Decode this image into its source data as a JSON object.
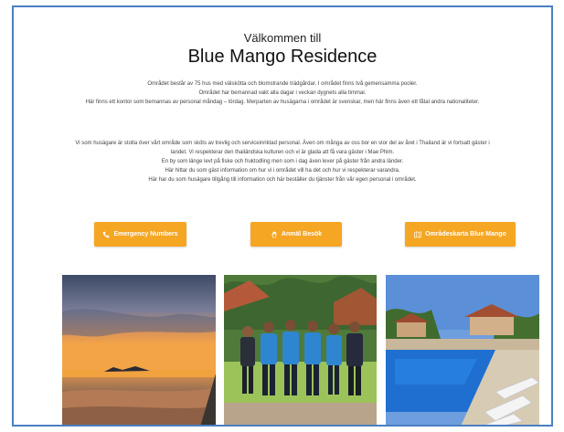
{
  "header": {
    "welcome": "Välkommen till",
    "title": "Blue Mango Residence"
  },
  "intro": {
    "paragraph1": [
      "Området består av 75 hus med välskötta och blomstrande trädgårdar. I området finns två gemensamma pooler.",
      "Området har bemannad vakt alla dagar i veckan dygnets alla timmar.",
      "Här finns ett kontor som bemannas av personal måndag – lördag. Merparten av husägarna i området är svenskar, men här finns även ett fåtal andra nationaliteter."
    ],
    "paragraph2": [
      "Vi som husägare är stolta över vårt område som sköts av trevlig och serviceinriktad personal. Även om många av oss bor en stor del av året i Thailand är vi fortsatt gäster i landet. Vi respekterar den thailändska kulturen och vi är glada att få vara gäster i Mae Phim.",
      "En by som länge levt på fiske och fruktodling men som i dag även lever på gäster från andra länder.",
      "Här hittar du som gäst information om hur vi i området vill ha det och hur vi respekterar varandra.",
      "Här har du som husägare tillgång till information och här beställer du tjänster från vår egen personal i området."
    ]
  },
  "buttons": {
    "emergency": {
      "label": "Emergency Numbers",
      "icon": "phone-icon"
    },
    "report": {
      "label": "Anmäl Besök",
      "icon": "hand-icon"
    },
    "map": {
      "label": "Områdeskarta Blue Mango",
      "icon": "map-icon"
    }
  },
  "colors": {
    "accent": "#f5a623",
    "frame": "#4a7fc2"
  },
  "photos": [
    {
      "name": "beach-sunset-photo"
    },
    {
      "name": "staff-group-photo"
    },
    {
      "name": "pool-photo"
    }
  ]
}
